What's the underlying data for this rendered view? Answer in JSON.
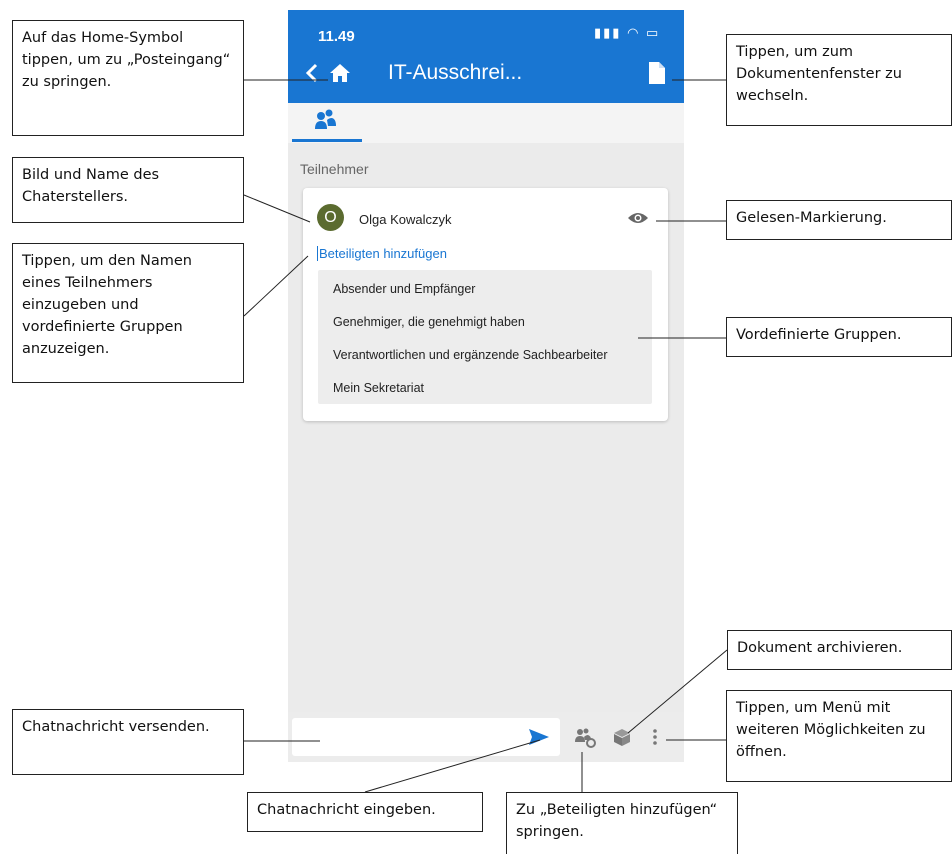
{
  "status_bar": {
    "time": "11.49",
    "icons": "▮▮▮ ◠ ▭"
  },
  "header": {
    "title": "IT-Ausschrei..."
  },
  "section": {
    "label": "Teilnehmer"
  },
  "creator": {
    "initial": "O",
    "name": "Olga Kowalczyk"
  },
  "add_participant": {
    "label": "Beteiligten hinzufügen"
  },
  "groups": [
    "Absender und Empfänger",
    "Genehmiger, die genehmigt haben",
    "Verantwortlichen und ergänzende Sachbearbeiter",
    "Mein Sekretariat"
  ],
  "chat_input": {
    "placeholder": ""
  },
  "colors": {
    "brand": "#1976d2",
    "avatar": "#5b6b2f",
    "background": "#ebebeb"
  },
  "icons": [
    "back-arrow-icon",
    "home-icon",
    "document-icon",
    "participants-icon",
    "eye-icon",
    "send-icon",
    "add-participant-icon",
    "archive-icon",
    "more-menu-icon"
  ],
  "callouts": {
    "home": "Auf das Home-Symbol tippen, um zu „Posteingang“ zu springen.",
    "creator": "Bild und Name des Chaterstellers.",
    "add": "Tippen, um den Namen eines Teilnehmers einzugeben und vordefinierte Gruppen anzuzeigen.",
    "send": "Chatnachricht versenden.",
    "input": "Chatnachricht eingeben.",
    "jump": "Zu „Beteiligten hinzufügen“ springen.",
    "doc": "Tippen, um zum Dokumentenfenster zu wechseln.",
    "read": "Gelesen-Markierung.",
    "groups": "Vordefinierte Gruppen.",
    "archive": "Dokument archivieren.",
    "menu": "Tippen, um Menü mit weiteren Möglichkeiten zu öffnen."
  }
}
